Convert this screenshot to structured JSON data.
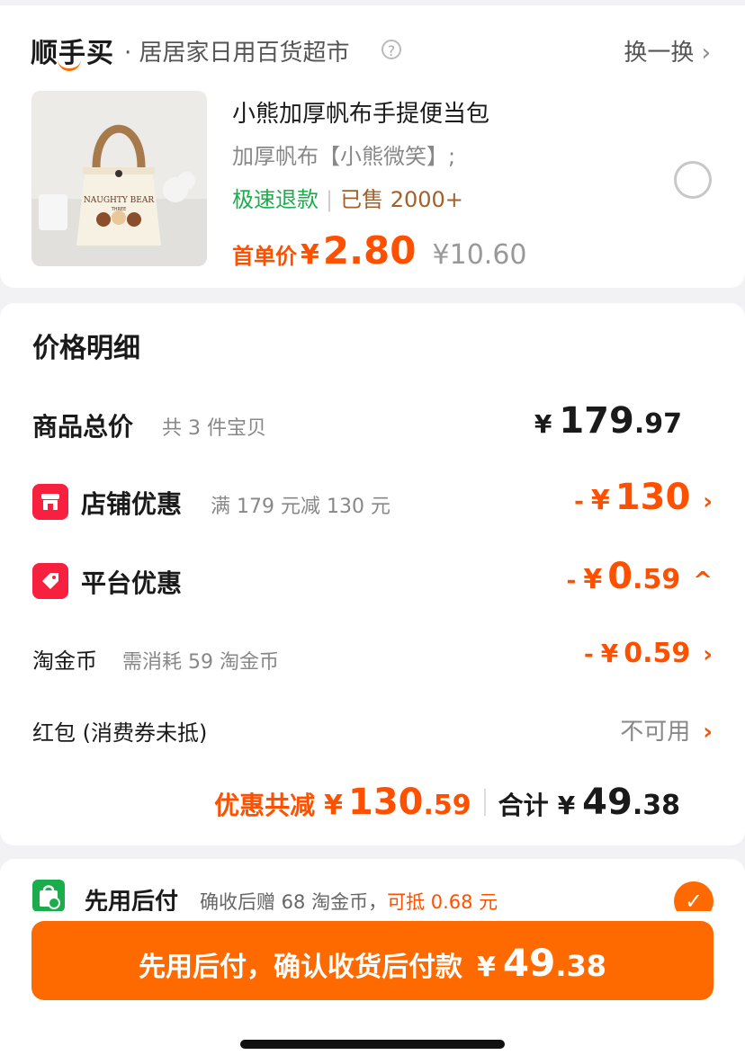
{
  "header": {
    "logo": "顺手买",
    "store": "· 居居家日用百货超市",
    "help_icon": "?",
    "swap_label": "换一换",
    "swap_chevron": "›"
  },
  "product": {
    "title": "小熊加厚帆布手提便当包",
    "spec": "加厚帆布【小熊微笑】;",
    "tag_refund": "极速退款",
    "tag_sep": "|",
    "tag_sold": "已售 2000+",
    "first_price_label": "首单价",
    "yen": "¥",
    "price": "2.80",
    "original_price": "¥10.60",
    "image_text": "NAUGHTY BEAR",
    "image_subtext": "THREE"
  },
  "detail": {
    "title": "价格明细",
    "total_goods": {
      "label": "商品总价",
      "sub": "共 3 件宝贝",
      "yen": "¥",
      "int": "179",
      "dec": ".97"
    },
    "store_discount": {
      "label": "店铺优惠",
      "sub": "满 179 元减 130 元",
      "minus": "-",
      "yen": "¥",
      "int": "130",
      "dec": "",
      "arrow": "›"
    },
    "platform_discount": {
      "label": "平台优惠",
      "minus": "-",
      "yen": "¥",
      "int": "0",
      "dec": ".59",
      "arrow": "^"
    },
    "coins": {
      "label": "淘金币",
      "sub": "需消耗 59 淘金币",
      "minus": "-",
      "yen": "¥",
      "value": "0.59",
      "arrow": "›"
    },
    "red_packet": {
      "label": "红包 (消费券未抵)",
      "value": "不可用",
      "arrow": "›"
    },
    "summary": {
      "discount_label": "优惠共减",
      "discount_yen": "¥",
      "discount_int": "130",
      "discount_dec": ".59",
      "total_label": "合计",
      "total_yen": "¥",
      "total_int": "49",
      "total_dec": ".38"
    }
  },
  "payment": {
    "title": "先用后付",
    "desc_prefix": "确收后赠 68 淘金币，",
    "desc_highlight": "可抵 0.68 元",
    "check": "✓"
  },
  "submit": {
    "text": "先用后付，确认收货后付款",
    "yen": "¥",
    "int": "49",
    "dec": ".38"
  },
  "colors": {
    "accent": "#ff6a00",
    "price": "#ff5000",
    "green": "#1bac4b",
    "badge_red": "#f7213f"
  }
}
